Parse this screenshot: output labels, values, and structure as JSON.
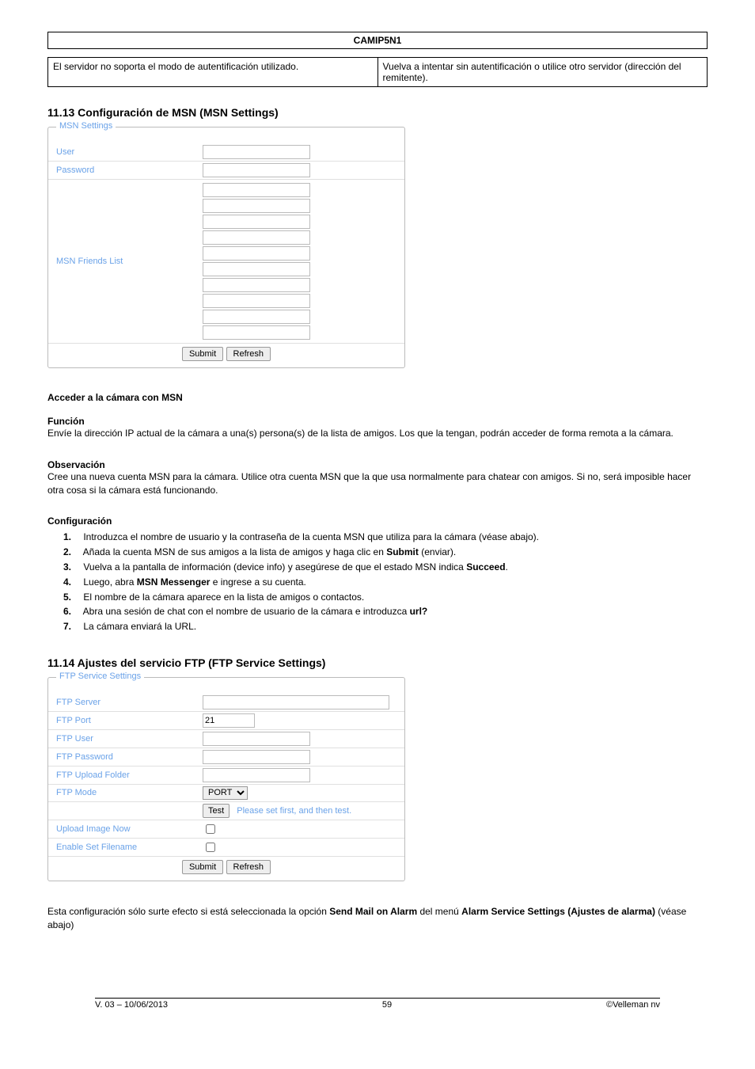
{
  "header": {
    "title": "CAMIP5N1"
  },
  "table1": {
    "left": "El servidor no soporta el modo de autentificación utilizado.",
    "right": "Vuelva a intentar sin autentificación o utilice otro servidor (dirección del remitente)."
  },
  "sec1113": {
    "heading": "11.13 Configuración de MSN (MSN Settings)",
    "legend": "MSN Settings",
    "rows": {
      "user": "User",
      "password": "Password",
      "friends": "MSN Friends List"
    },
    "buttons": {
      "submit": "Submit",
      "refresh": "Refresh"
    }
  },
  "msn_access": {
    "heading": "Acceder a la cámara con MSN",
    "funcion_h": "Función",
    "funcion_text": "Envíe la dirección IP actual de la cámara a una(s) persona(s) de la lista de amigos. Los que la tengan, podrán acceder de forma remota a la cámara.",
    "obs_h": "Observación",
    "obs_text": "Cree una nueva cuenta MSN para la cámara. Utilice otra cuenta MSN que la que usa normalmente para chatear con amigos. Si no, será imposible hacer otra cosa si la cámara está funcionando.",
    "conf_h": "Configuración",
    "steps": [
      "Introduzca el nombre de usuario y la contraseña de la cuenta MSN que utiliza para la cámara (véase abajo).",
      "Añada la cuenta MSN de sus amigos a la lista de amigos y haga clic en <b>Submit</b> (enviar).",
      "Vuelva a la pantalla de información (device info) y asegúrese de que el estado MSN indica <b>Succeed</b>.",
      "Luego, abra <b>MSN Messenger</b> e ingrese a su cuenta.",
      "El nombre de la cámara aparece en la lista de amigos o contactos.",
      "Abra una sesión de chat con el nombre de usuario de la cámara e introduzca <b>url?</b>",
      "La cámara enviará la URL."
    ]
  },
  "sec1114": {
    "heading": "11.14 Ajustes del servicio FTP (FTP Service Settings)",
    "legend": "FTP Service Settings",
    "rows": {
      "server": "FTP Server",
      "port": "FTP Port",
      "port_value": "21",
      "user": "FTP User",
      "password": "FTP Password",
      "upload_folder": "FTP Upload Folder",
      "mode": "FTP Mode",
      "mode_value": "PORT",
      "test_btn": "Test",
      "test_hint": "Please set first, and then test.",
      "upload_now": "Upload Image Now",
      "enable_filename": "Enable Set Filename"
    },
    "buttons": {
      "submit": "Submit",
      "refresh": "Refresh"
    }
  },
  "post_ftp_text": "Esta configuración sólo surte efecto si está seleccionada la opción <b>Send Mail on Alarm</b> del menú <b>Alarm Service Settings (Ajustes de alarma)</b> (véase abajo)",
  "footer": {
    "left": "V. 03 – 10/06/2013",
    "center": "59",
    "right": "©Velleman nv"
  }
}
